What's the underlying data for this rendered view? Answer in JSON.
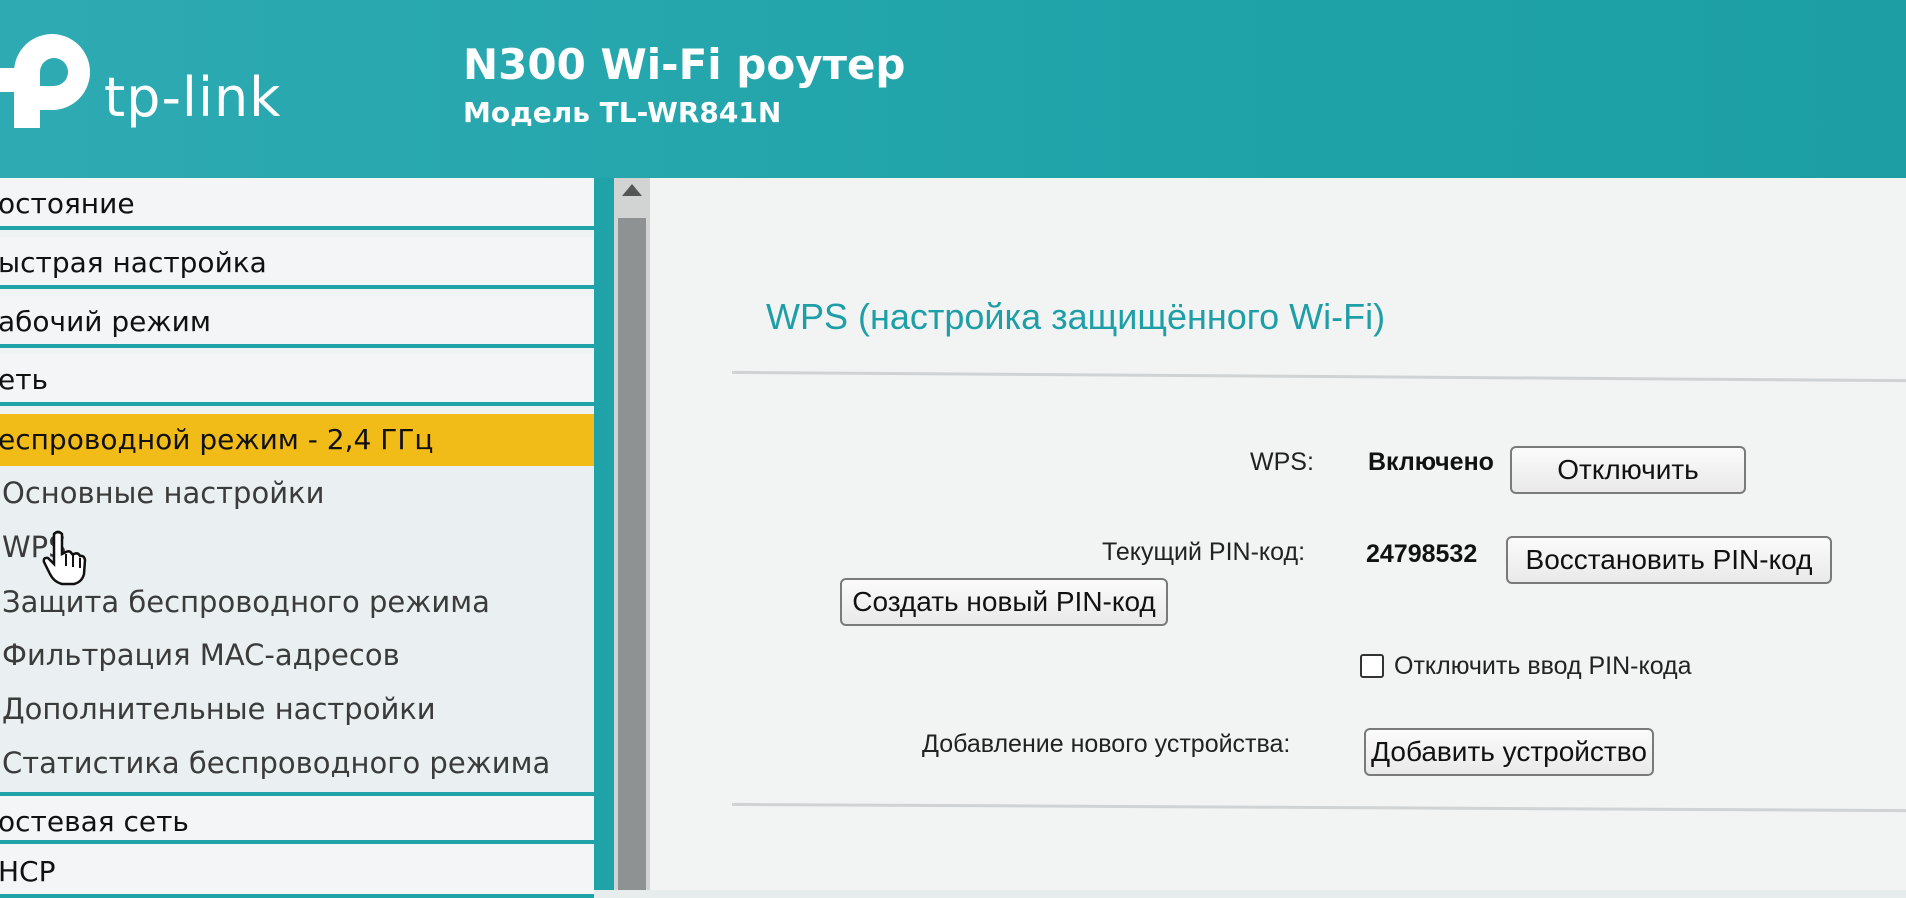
{
  "header": {
    "brand": "tp-link",
    "title": "N300 Wi-Fi роутер",
    "model": "Модель TL-WR841N"
  },
  "sidebar": {
    "items": [
      {
        "label": "остояние"
      },
      {
        "label": "ыстрая настройка"
      },
      {
        "label": "абочий режим"
      },
      {
        "label": "еть"
      },
      {
        "label": "еспроводной режим - 2,4 ГГц",
        "active": true
      }
    ],
    "subitems": [
      {
        "label": "Основные настройки"
      },
      {
        "label": "WPS",
        "selected": true
      },
      {
        "label": "Защита беспроводного режима"
      },
      {
        "label": "Фильтрация MAC-адресов"
      },
      {
        "label": "Дополнительные настройки"
      },
      {
        "label": "Статистика беспроводного режима"
      }
    ],
    "bottom_items": [
      {
        "label": "остевая сеть"
      },
      {
        "label": "HCP"
      }
    ]
  },
  "main": {
    "title": "WPS (настройка защищённого Wi-Fi)",
    "wps_label": "WPS:",
    "wps_status": "Включено",
    "disable_button": "Отключить",
    "pin_label": "Текущий PIN-код:",
    "pin_value": "24798532",
    "restore_pin_button": "Восстановить PIN-код",
    "new_pin_button": "Создать новый PIN-код",
    "disable_pin_checkbox_label": "Отключить ввод PIN-кода",
    "disable_pin_checked": false,
    "add_device_label": "Добавление нового устройства:",
    "add_device_button": "Добавить устройство"
  },
  "colors": {
    "header_bg": "#1fa3a9",
    "active_menu": "#f1bc17",
    "title_text": "#1e9ea6"
  }
}
